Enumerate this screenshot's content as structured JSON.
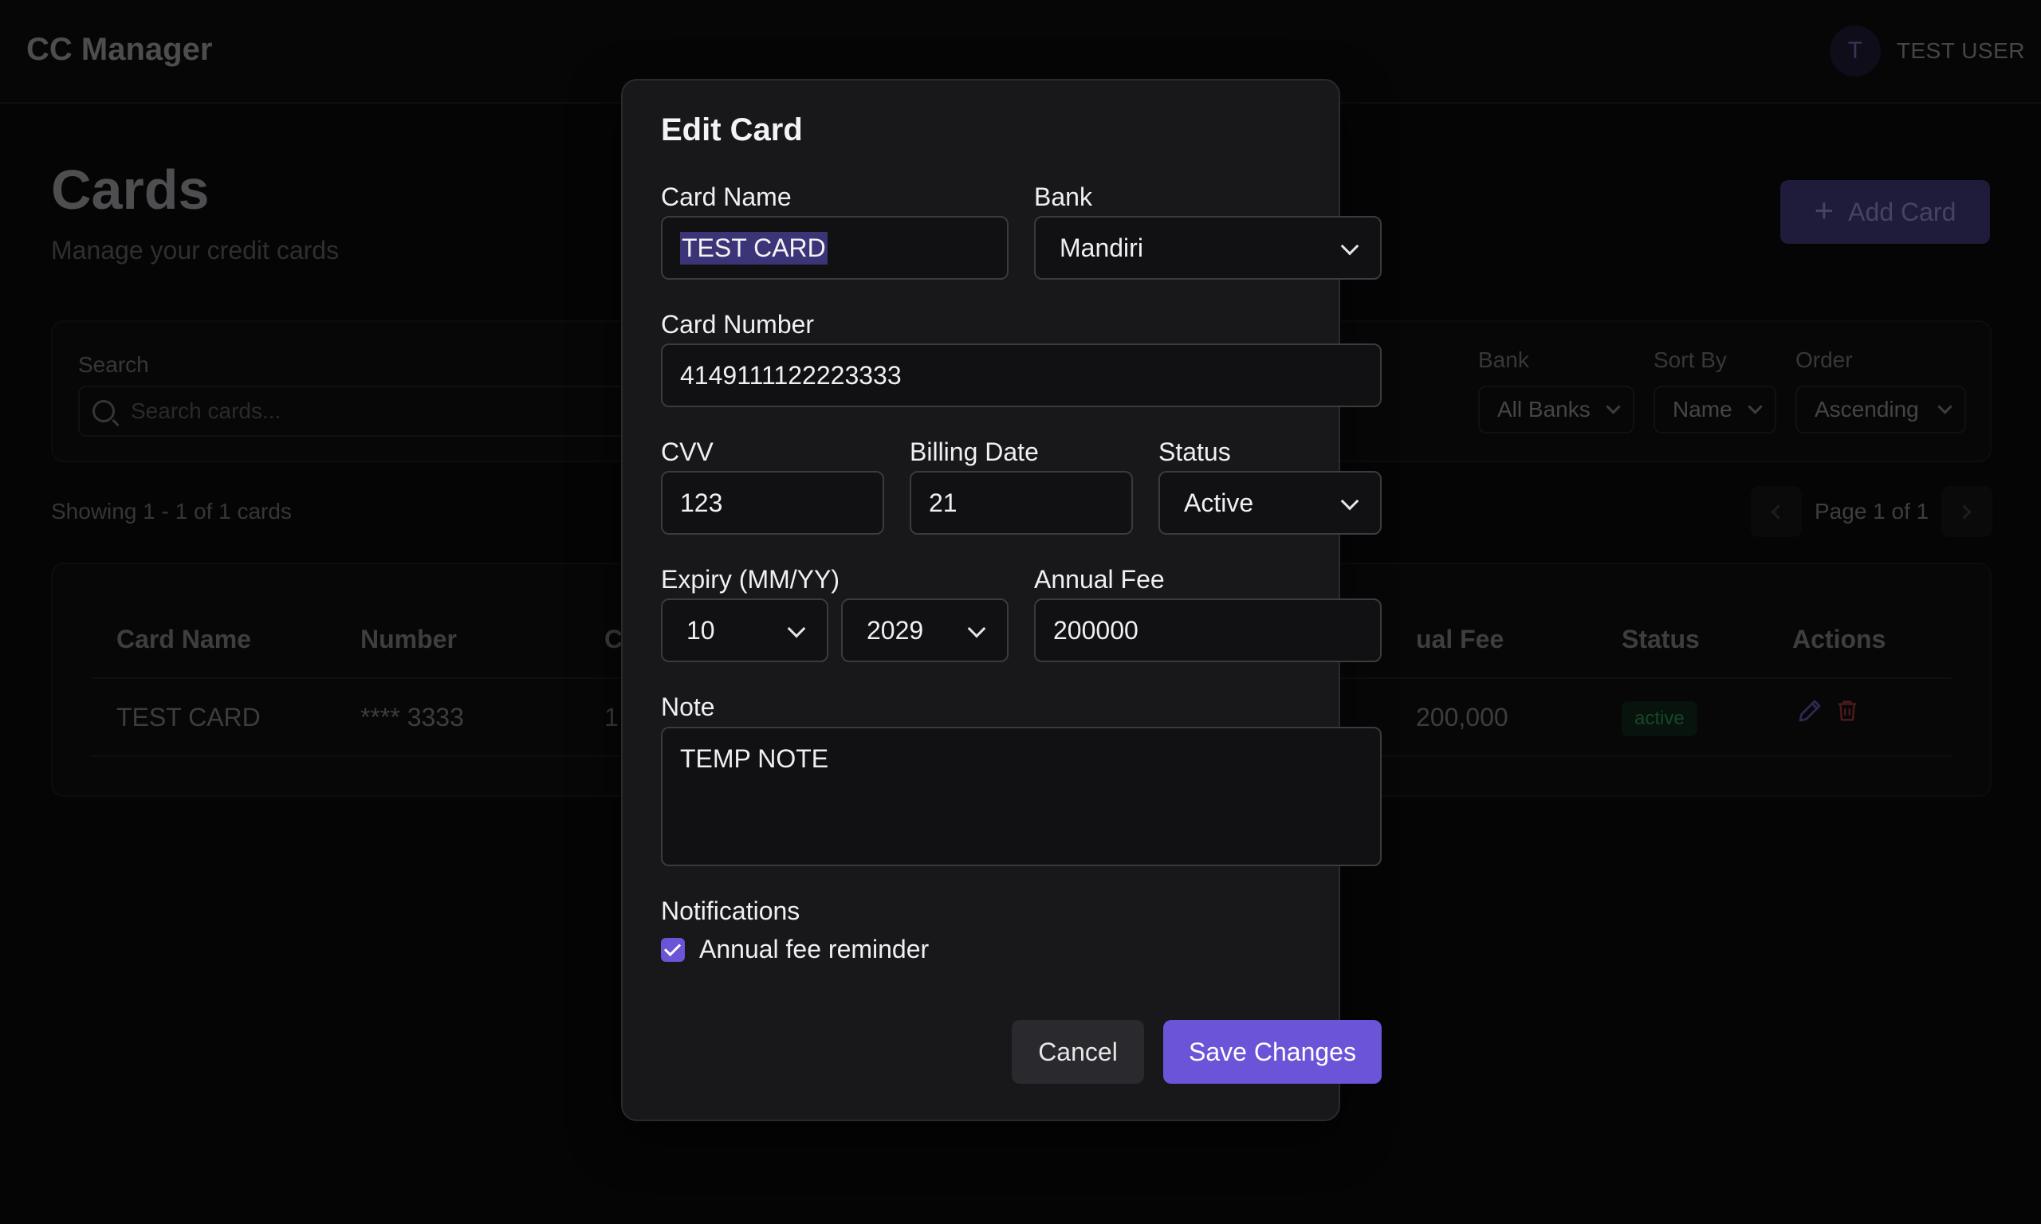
{
  "app": {
    "brand": "CC Manager",
    "user_initial": "T",
    "user_name": "TEST USER"
  },
  "page": {
    "title": "Cards",
    "subtitle": "Manage your credit cards",
    "add_button": "Add Card"
  },
  "filters": {
    "search_label": "Search",
    "search_placeholder": "Search cards...",
    "bank_label": "Bank",
    "bank_value": "All Banks",
    "sort_label": "Sort By",
    "sort_value": "Name",
    "order_label": "Order",
    "order_value": "Ascending"
  },
  "listing": {
    "showing": "Showing 1 - 1 of 1 cards",
    "page_text": "Page 1 of 1"
  },
  "table": {
    "headers": {
      "card_name": "Card Name",
      "number": "Number",
      "partial_c": "C",
      "annual_fee_partial": "ual Fee",
      "status": "Status",
      "actions": "Actions"
    },
    "row": {
      "card_name": "TEST CARD",
      "number": "**** 3333",
      "partial_c": "1",
      "annual_fee": "200,000",
      "status": "active"
    }
  },
  "modal": {
    "title": "Edit Card",
    "card_name_label": "Card Name",
    "card_name_value": "TEST CARD",
    "bank_label": "Bank",
    "bank_value": "Mandiri",
    "card_number_label": "Card Number",
    "card_number_value": "4149111122223333",
    "cvv_label": "CVV",
    "cvv_value": "123",
    "billing_label": "Billing Date",
    "billing_value": "21",
    "status_label": "Status",
    "status_value": "Active",
    "expiry_label": "Expiry (MM/YY)",
    "expiry_month": "10",
    "expiry_year": "2029",
    "annual_fee_label": "Annual Fee",
    "annual_fee_value": "200000",
    "note_label": "Note",
    "note_value": "TEMP NOTE",
    "notifications_label": "Notifications",
    "reminder_label": "Annual fee reminder",
    "reminder_checked": true,
    "cancel": "Cancel",
    "save": "Save Changes"
  },
  "colors": {
    "accent": "#6c54d8",
    "danger": "#b83a3a",
    "success": "#2f8d55"
  }
}
